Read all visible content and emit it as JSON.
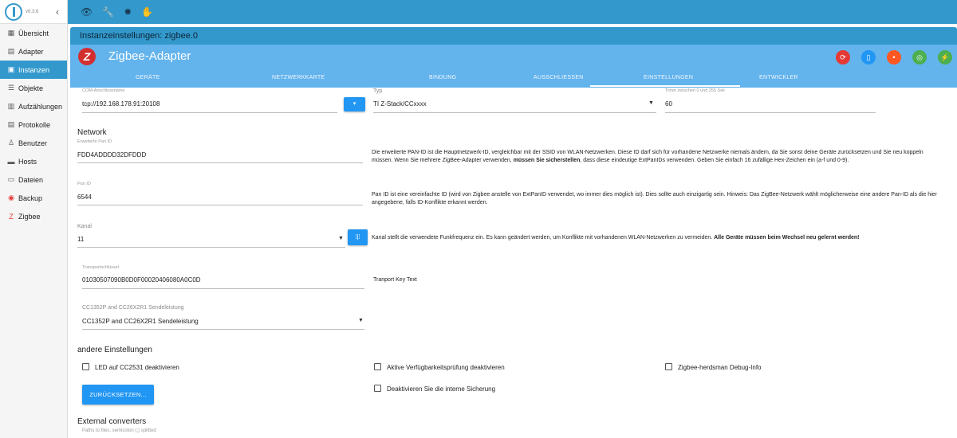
{
  "app": {
    "version": "v6.3.6"
  },
  "sidebar": {
    "items": [
      {
        "label": "Übersicht",
        "icon": "grid-icon",
        "glyph": "▦",
        "active": false
      },
      {
        "label": "Adapter",
        "icon": "store-icon",
        "glyph": "▤",
        "active": false
      },
      {
        "label": "Instanzen",
        "icon": "instances-icon",
        "glyph": "▣",
        "active": true
      },
      {
        "label": "Objekte",
        "icon": "list-icon",
        "glyph": "☰",
        "active": false
      },
      {
        "label": "Aufzählungen",
        "icon": "enum-icon",
        "glyph": "▥",
        "active": false
      },
      {
        "label": "Protokolle",
        "icon": "log-icon",
        "glyph": "▤",
        "active": false
      },
      {
        "label": "Benutzer",
        "icon": "user-icon",
        "glyph": "♙",
        "active": false
      },
      {
        "label": "Hosts",
        "icon": "host-icon",
        "glyph": "▬",
        "active": false
      },
      {
        "label": "Dateien",
        "icon": "files-icon",
        "glyph": "▭",
        "active": false
      },
      {
        "label": "Backup",
        "icon": "backup-icon",
        "glyph": "◉",
        "active": false
      },
      {
        "label": "Zigbee",
        "icon": "zigbee-icon",
        "glyph": "Z",
        "active": false
      }
    ]
  },
  "topbar": {
    "icons": [
      "eye-icon",
      "wrench-icon",
      "bug-icon",
      "hand-icon"
    ]
  },
  "instance_title": "Instanzeinstellungen: zigbee.0",
  "adapter": {
    "name": "Zigbee-Adapter",
    "logo_letter": "Z",
    "header_buttons": [
      {
        "name": "reset-button",
        "glyph": "⟳",
        "color": "#e53935"
      },
      {
        "name": "device-button",
        "glyph": "▯",
        "color": "#2196f3"
      },
      {
        "name": "pairing-button",
        "glyph": "•",
        "color": "#ff5722"
      },
      {
        "name": "wifi-button",
        "glyph": "◎",
        "color": "#4caf50"
      },
      {
        "name": "network-button",
        "glyph": "⚡",
        "color": "#4caf50"
      }
    ]
  },
  "tabs": [
    "GERÄTE",
    "NETZWERKKARTE",
    "BINDUNG",
    "AUSSCHLIESSEN",
    "EINSTELLUNGEN",
    "ENTWICKLER"
  ],
  "settings": {
    "com_label": "COM-Anschlussname",
    "com_value": "tcp://192.168.178.91:20108",
    "typ_label": "Typ",
    "typ_value": "TI Z-Stack/CCxxxx",
    "timer_label": "Timer zwischen 0 und 255 Sek",
    "timer_value": "60",
    "network_title": "Network",
    "extpan_label": "Erweiterte Pan ID",
    "extpan_value": "FDD4ADDDD32DFDDD",
    "extpan_desc_1": "Die erweiterte PAN-ID ist die Hauptnetzwerk-ID, vergleichbar mit der SSID von WLAN-Netzwerken. Diese ID darf sich für vorhandene Netzwerke niemals ändern, da Sie sonst deine Geräte zurücksetzen und Sie neu koppeln",
    "extpan_desc_2a": "müssen. Wenn Sie mehrere ZigBee-Adapter verwenden, ",
    "extpan_desc_2b": "müssen Sie sicherstellen",
    "extpan_desc_2c": ", dass diese eindeutige ExtPanIDs verwenden. Geben Sie einfach 16 zufällige Hex-Zeichen ein (a-f und 0-9).",
    "panid_label": "Pan ID",
    "panid_value": "6544",
    "panid_desc": "Pan ID ist eine vereinfachte ID (wird von Zigbee anstelle von ExtPanID verwendet, wo immer dies möglich ist). Dies sollte auch einzigartig sein. Hinweis: Das ZigBee-Netzwerk wählt möglicherweise eine andere Pan-ID als die hier angegebene, falls ID-Konflikte erkannt werden.",
    "kanal_label": "Kanal",
    "kanal_value": "11",
    "kanal_desc_a": "Kanal stellt die verwendete Funkfrequenz ein. Es kann geändert werden, um Konflikte mit vorhandenen WLAN-Netzwerken zu vermeiden. ",
    "kanal_desc_b": "Alle Geräte müssen beim Wechsel neu gelernt werden!",
    "transport_label": "Transportschlüssel",
    "transport_value": "01030507090B0D0F00020406080A0C0D",
    "transport_desc": "Tranport Key Text",
    "power_label": "CC1352P and CC26X2R1 Sendeleistung",
    "power_value": "CC1352P and CC26X2R1 Sendeleistung",
    "other_title": "andere Einstellungen",
    "cb_led": "LED auf CC2531 deaktivieren",
    "cb_avail": "Aktive Verfügbarkeitsprüfung deaktivieren",
    "cb_debug": "Zigbee-herdsman Debug-Info",
    "cb_backup": "Deaktivieren Sie die interne Sicherung",
    "reset_label": "ZURÜCKSETZEN...",
    "ext_title": "External converters",
    "ext_sub": "Paths to files, semicolon (;) splitted"
  }
}
